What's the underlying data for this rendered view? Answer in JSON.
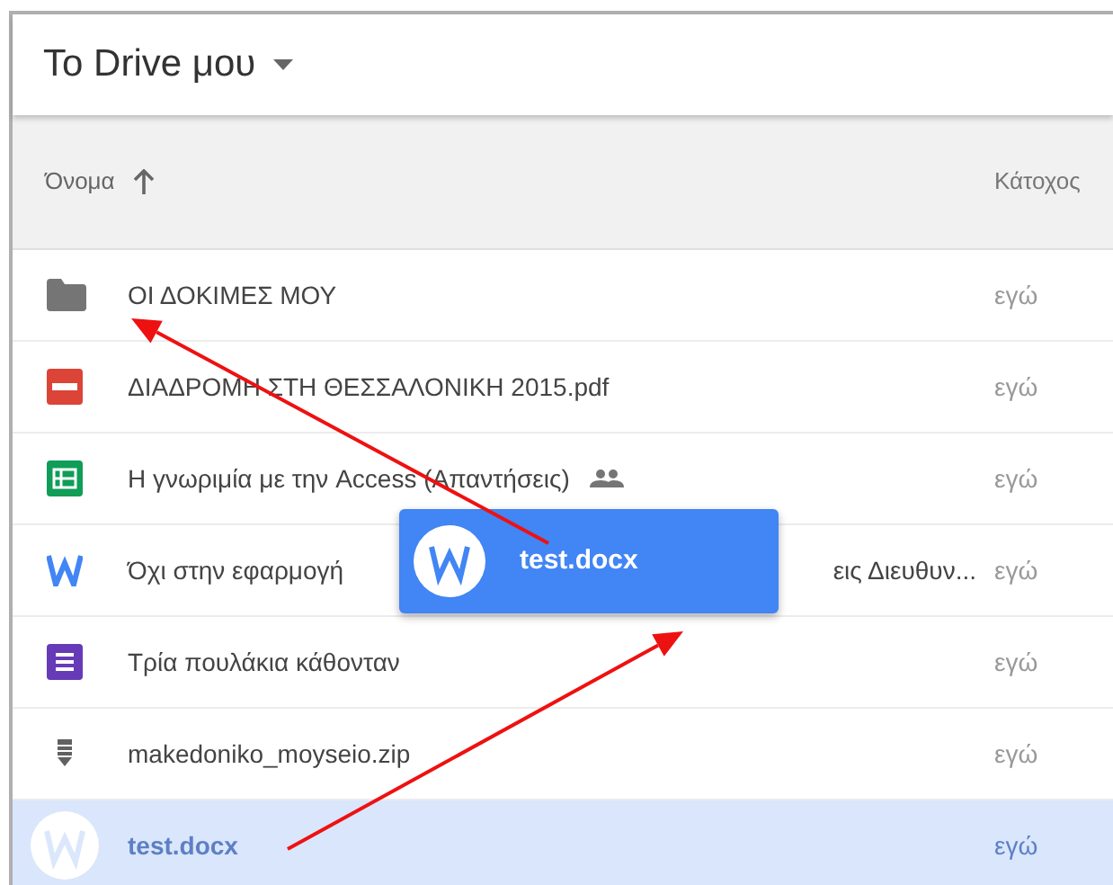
{
  "header": {
    "title": "Το Drive μου"
  },
  "columns": [
    {
      "label": "Όνομα",
      "sorted": true
    },
    {
      "label": "Κάτοχος",
      "sorted": false
    }
  ],
  "rows": [
    {
      "kind": "folder",
      "name": "ΟΙ ΔΟΚΙΜΕΣ ΜΟΥ",
      "owner": "εγώ",
      "shared": false,
      "selected": false
    },
    {
      "kind": "pdf",
      "name": "ΔΙΑΔΡΟΜΗ ΣΤΗ ΘΕΣΣΑΛΟΝΙΚΗ 2015.pdf",
      "owner": "εγώ",
      "shared": false,
      "selected": false
    },
    {
      "kind": "sheet",
      "name": "Η γνωριμία με την Access (Απαντήσεις)",
      "owner": "εγώ",
      "shared": true,
      "selected": false
    },
    {
      "kind": "word",
      "name": "Όχι στην εφαρμογή",
      "name_end": "εις Διευθυν...",
      "owner": "εγώ",
      "shared": false,
      "selected": false
    },
    {
      "kind": "form",
      "name": "Τρία πουλάκια κάθονταν",
      "owner": "εγώ",
      "shared": false,
      "selected": false
    },
    {
      "kind": "zip",
      "name": "makedoniko_moyseio.zip",
      "owner": "εγώ",
      "shared": false,
      "selected": false
    },
    {
      "kind": "word",
      "name": "test.docx",
      "owner": "εγώ",
      "shared": false,
      "selected": true
    }
  ],
  "drag_card": {
    "name": "test.docx"
  },
  "annotations": [
    {
      "kind": "arrow"
    },
    {
      "kind": "arrow"
    }
  ]
}
